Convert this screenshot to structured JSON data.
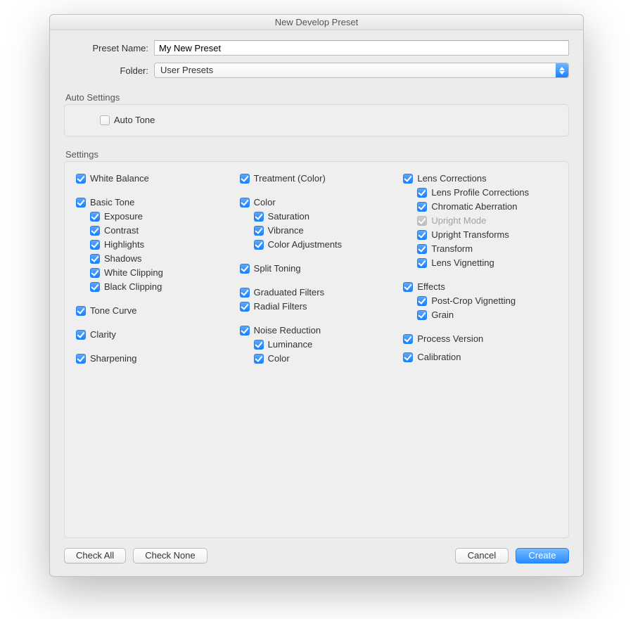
{
  "title": "New Develop Preset",
  "form": {
    "preset_label": "Preset Name:",
    "preset_value": "My New Preset",
    "folder_label": "Folder:",
    "folder_value": "User Presets"
  },
  "auto": {
    "heading": "Auto Settings",
    "auto_tone": "Auto Tone"
  },
  "settings_heading": "Settings",
  "col1": {
    "white_balance": "White Balance",
    "basic_tone": "Basic Tone",
    "exposure": "Exposure",
    "contrast": "Contrast",
    "highlights": "Highlights",
    "shadows": "Shadows",
    "white_clipping": "White Clipping",
    "black_clipping": "Black Clipping",
    "tone_curve": "Tone Curve",
    "clarity": "Clarity",
    "sharpening": "Sharpening"
  },
  "col2": {
    "treatment": "Treatment (Color)",
    "color": "Color",
    "saturation": "Saturation",
    "vibrance": "Vibrance",
    "color_adjustments": "Color Adjustments",
    "split_toning": "Split Toning",
    "graduated_filters": "Graduated Filters",
    "radial_filters": "Radial Filters",
    "noise_reduction": "Noise Reduction",
    "luminance": "Luminance",
    "nr_color": "Color"
  },
  "col3": {
    "lens_corrections": "Lens Corrections",
    "lens_profile_corrections": "Lens Profile Corrections",
    "chromatic_aberration": "Chromatic Aberration",
    "upright_mode": "Upright Mode",
    "upright_transforms": "Upright Transforms",
    "transform": "Transform",
    "lens_vignetting": "Lens Vignetting",
    "effects": "Effects",
    "post_crop_vignetting": "Post-Crop Vignetting",
    "grain": "Grain",
    "process_version": "Process Version",
    "calibration": "Calibration"
  },
  "buttons": {
    "check_all": "Check All",
    "check_none": "Check None",
    "cancel": "Cancel",
    "create": "Create"
  }
}
